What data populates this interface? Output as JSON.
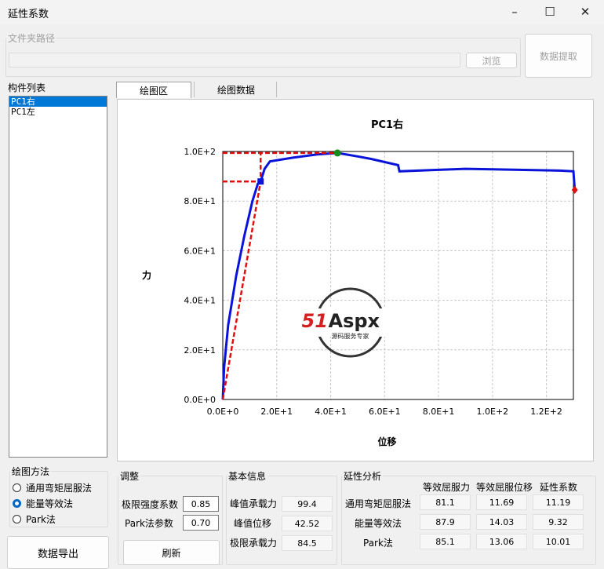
{
  "window": {
    "title": "延性系数",
    "minimize": "–",
    "maximize": "☐",
    "close": "✕"
  },
  "folder": {
    "legend": "文件夹路径",
    "path": "",
    "browse": "浏览",
    "extract": "数据提取"
  },
  "members": {
    "legend": "构件列表",
    "items": [
      "PC1右",
      "PC1左"
    ],
    "selected": 0
  },
  "tabs": [
    {
      "label": "绘图区"
    },
    {
      "label": "绘图数据"
    }
  ],
  "method": {
    "legend": "绘图方法",
    "options": [
      "通用弯矩屈服法",
      "能量等效法",
      "Park法"
    ],
    "selected": 1
  },
  "export_button": "数据导出",
  "adjust": {
    "legend": "调整",
    "ultimate_label": "极限强度系数",
    "ultimate_value": "0.85",
    "park_label": "Park法参数",
    "park_value": "0.70",
    "refresh": "刷新"
  },
  "basic": {
    "legend": "基本信息",
    "rows": [
      {
        "label": "峰值承载力",
        "value": "99.4"
      },
      {
        "label": "峰值位移",
        "value": "42.52"
      },
      {
        "label": "极限承载力",
        "value": "84.5"
      }
    ]
  },
  "ductility": {
    "legend": "延性分析",
    "headers": [
      "等效屈服力",
      "等效屈服位移",
      "延性系数"
    ],
    "rows": [
      {
        "method": "通用弯矩屈服法",
        "values": [
          "81.1",
          "11.69",
          "11.19"
        ]
      },
      {
        "method": "能量等效法",
        "values": [
          "87.9",
          "14.03",
          "9.32"
        ]
      },
      {
        "method": "Park法",
        "values": [
          "85.1",
          "13.06",
          "10.01"
        ]
      }
    ]
  },
  "watermark": {
    "text": "51Aspx",
    "subtext": "源码服务专家"
  },
  "colors": {
    "curve": "#0a14d8",
    "dashed": "#e01010",
    "peak": "#1a8a1a",
    "selection": "#0078d7"
  },
  "chart_data": {
    "type": "line",
    "title": "PC1右",
    "xlabel": "位移",
    "ylabel": "力",
    "xlim": [
      0,
      130
    ],
    "ylim": [
      0,
      100
    ],
    "xticks": [
      0,
      20,
      40,
      60,
      80,
      100,
      120
    ],
    "xtick_labels": [
      "0.0E+0",
      "2.0E+1",
      "4.0E+1",
      "6.0E+1",
      "8.0E+1",
      "1.0E+2",
      "1.2E+2"
    ],
    "yticks": [
      0,
      20,
      40,
      60,
      80,
      100
    ],
    "ytick_labels": [
      "0.0E+0",
      "2.0E+1",
      "4.0E+1",
      "6.0E+1",
      "8.0E+1",
      "1.0E+2"
    ],
    "grid": true,
    "series": [
      {
        "style": "solid",
        "color": "#0a14d8",
        "x": [
          0,
          0.5,
          2,
          5,
          8,
          11,
          13,
          14.03,
          15.5,
          17.5,
          26,
          35,
          42.52,
          50,
          55,
          65,
          65.5,
          80,
          90,
          110,
          125,
          130,
          130.5
        ],
        "y": [
          0,
          13,
          30,
          50,
          66,
          80,
          87,
          87.9,
          93,
          96,
          97.5,
          98.8,
          99.4,
          98,
          97,
          94.5,
          92,
          92.6,
          93,
          92.6,
          92.3,
          92,
          84.5
        ]
      },
      {
        "style": "dashed",
        "color": "#e01010",
        "x": [
          0,
          14.03,
          14.03,
          42.52
        ],
        "y": [
          0,
          87.9,
          99.4,
          99.4
        ]
      },
      {
        "style": "dashed",
        "color": "#e01010",
        "x": [
          0,
          14.03
        ],
        "y": [
          87.9,
          87.9
        ]
      },
      {
        "style": "dashed",
        "color": "#e01010",
        "x": [
          0,
          14.03
        ],
        "y": [
          99.4,
          99.4
        ]
      }
    ],
    "markers": [
      {
        "shape": "square",
        "color": "#0a14d8",
        "x": 14.03,
        "y": 87.9
      },
      {
        "shape": "circle",
        "color": "#1a8a1a",
        "x": 42.52,
        "y": 99.4
      },
      {
        "shape": "diamond",
        "color": "#e01010",
        "x": 130.5,
        "y": 84.5
      }
    ]
  }
}
